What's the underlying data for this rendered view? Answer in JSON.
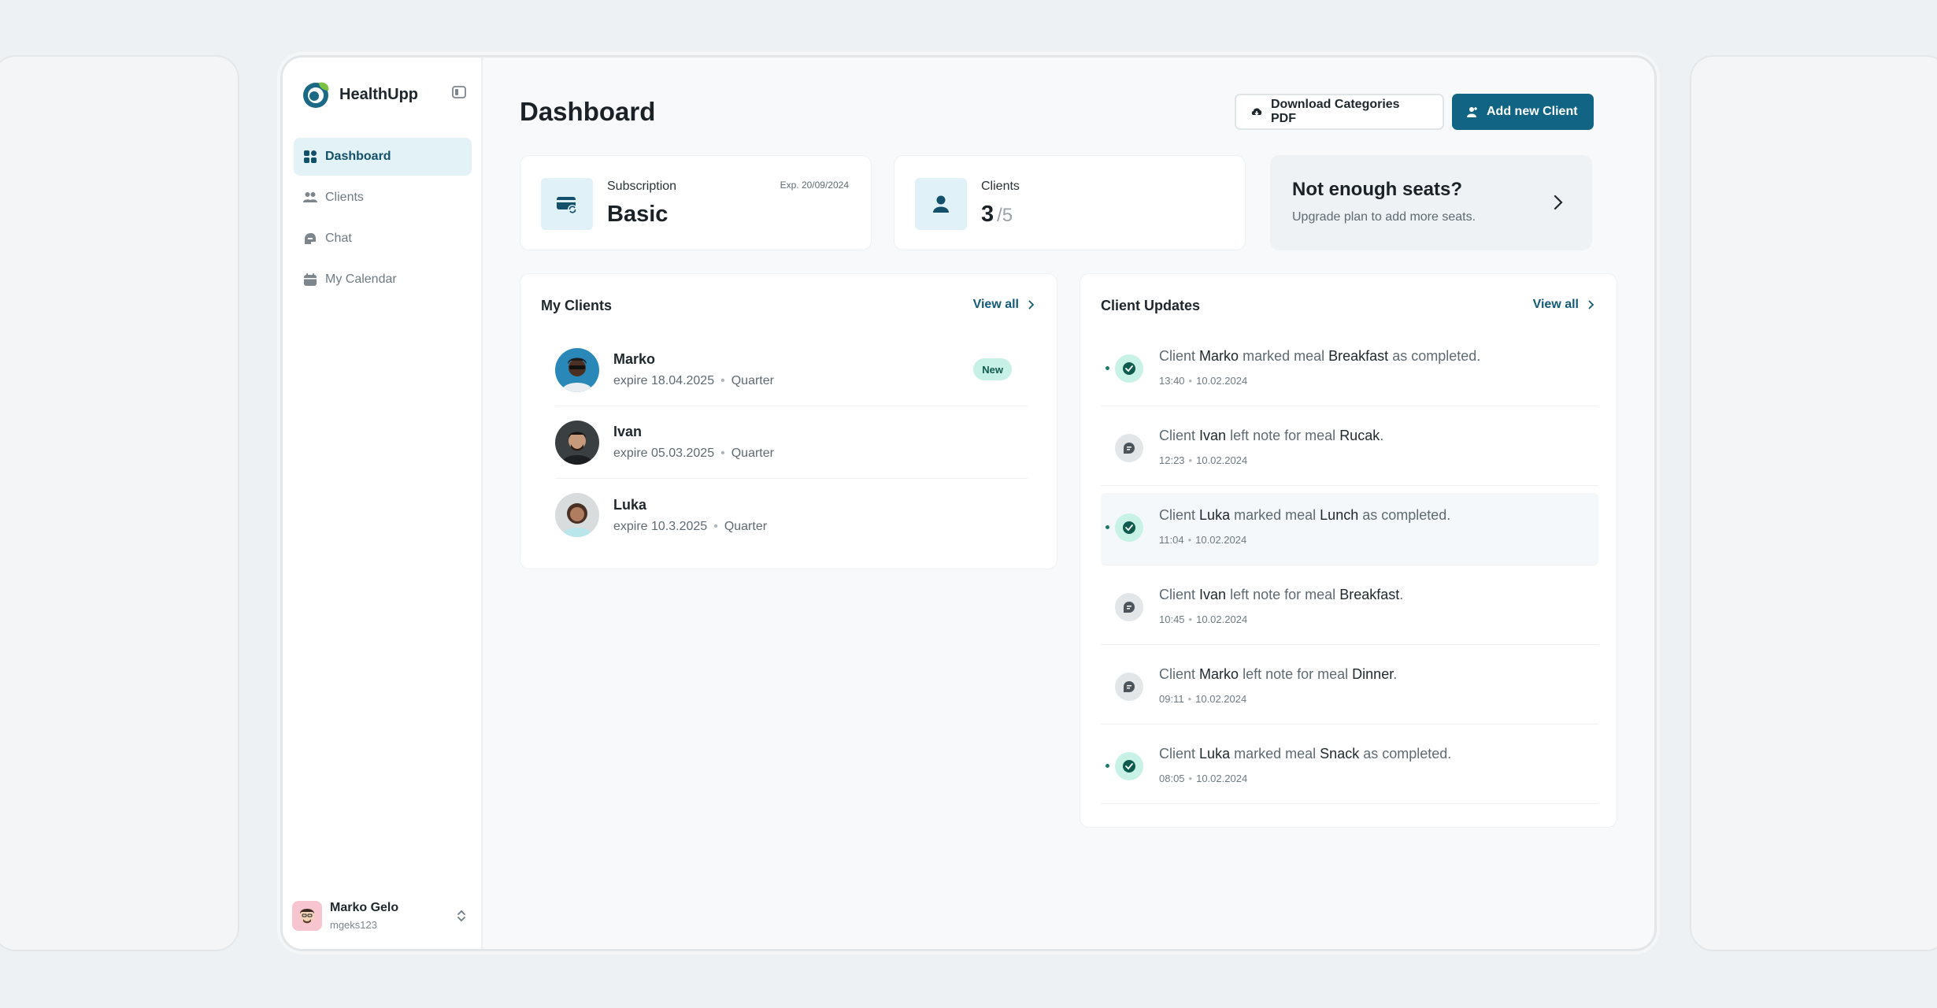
{
  "brand": {
    "name": "HealthUpp",
    "logo_icon": "healthupp-logo-icon",
    "accent": "#116484"
  },
  "nav": {
    "items": [
      {
        "label": "Dashboard",
        "icon": "grid-icon",
        "active": true
      },
      {
        "label": "Clients",
        "icon": "users-icon",
        "active": false
      },
      {
        "label": "Chat",
        "icon": "chat-icon",
        "active": false
      },
      {
        "label": "My Calendar",
        "icon": "calendar-icon",
        "active": false
      }
    ]
  },
  "user": {
    "name": "Marko Gelo",
    "handle": "mgeks123"
  },
  "header": {
    "title": "Dashboard",
    "download_label": "Download Categories PDF",
    "add_label": "Add new Client"
  },
  "subscription": {
    "label": "Subscription",
    "plan": "Basic",
    "expiry": "Exp. 20/09/2024"
  },
  "clients_stat": {
    "label": "Clients",
    "count": "3",
    "total": "/5"
  },
  "upsell": {
    "title": "Not enough seats?",
    "subtitle": "Upgrade plan to add more seats."
  },
  "my_clients": {
    "title": "My Clients",
    "view_all": "View all",
    "items": [
      {
        "name": "Marko",
        "expire": "expire 18.04.2025",
        "plan": "Quarter",
        "badge": "New"
      },
      {
        "name": "Ivan",
        "expire": "expire 05.03.2025",
        "plan": "Quarter",
        "badge": ""
      },
      {
        "name": "Luka",
        "expire": "expire 10.3.2025",
        "plan": "Quarter",
        "badge": ""
      }
    ]
  },
  "client_updates": {
    "title": "Client Updates",
    "view_all": "View all",
    "items": [
      {
        "type": "done",
        "prefix": "Client",
        "client": "Marko",
        "action": "marked meal",
        "meal": "Breakfast",
        "suffix": "as completed.",
        "time": "13:40",
        "date": "10.02.2024",
        "unread": true
      },
      {
        "type": "note",
        "prefix": "Client",
        "client": "Ivan",
        "action": "left note for meal",
        "meal": "Rucak",
        "suffix": ".",
        "time": "12:23",
        "date": "10.02.2024",
        "unread": false
      },
      {
        "type": "done",
        "prefix": "Client",
        "client": "Luka",
        "action": "marked meal",
        "meal": "Lunch",
        "suffix": "as completed.",
        "time": "11:04",
        "date": "10.02.2024",
        "unread": true
      },
      {
        "type": "note",
        "prefix": "Client",
        "client": "Ivan",
        "action": "left note for meal",
        "meal": "Breakfast",
        "suffix": ".",
        "time": "10:45",
        "date": "10.02.2024",
        "unread": false
      },
      {
        "type": "note",
        "prefix": "Client",
        "client": "Marko",
        "action": "left note for meal",
        "meal": "Dinner",
        "suffix": ".",
        "time": "09:11",
        "date": "10.02.2024",
        "unread": false
      },
      {
        "type": "done",
        "prefix": "Client",
        "client": "Luka",
        "action": "marked meal",
        "meal": "Snack",
        "suffix": "as completed.",
        "time": "08:05",
        "date": "10.02.2024",
        "unread": true
      }
    ]
  }
}
